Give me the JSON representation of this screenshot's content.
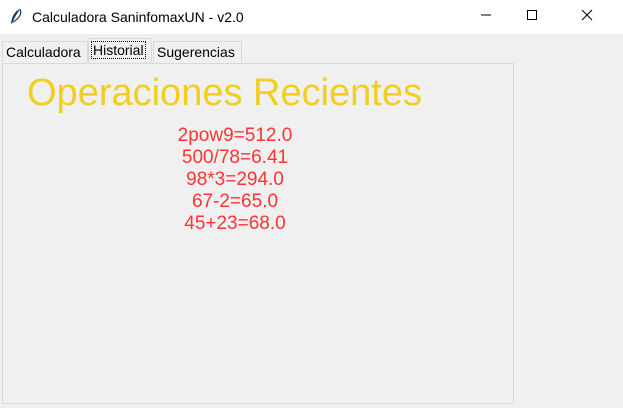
{
  "window": {
    "title": "Calculadora SaninfomaxUN - v2.0",
    "icon": "feather-icon",
    "controls": [
      "minimize-icon",
      "maximize-icon",
      "close-icon"
    ]
  },
  "tabs": [
    {
      "label": "Calculadora",
      "selected": false
    },
    {
      "label": "Historial",
      "selected": true
    },
    {
      "label": "Sugerencias",
      "selected": false
    }
  ],
  "historial": {
    "heading": "Operaciones Recientes",
    "operations": [
      "2pow9=512.0",
      "500/78=6.41",
      "98*3=294.0",
      "67-2=65.0",
      "45+23=68.0"
    ]
  },
  "colors": {
    "heading": "#f2cf1d",
    "operations": "#ff3333"
  }
}
